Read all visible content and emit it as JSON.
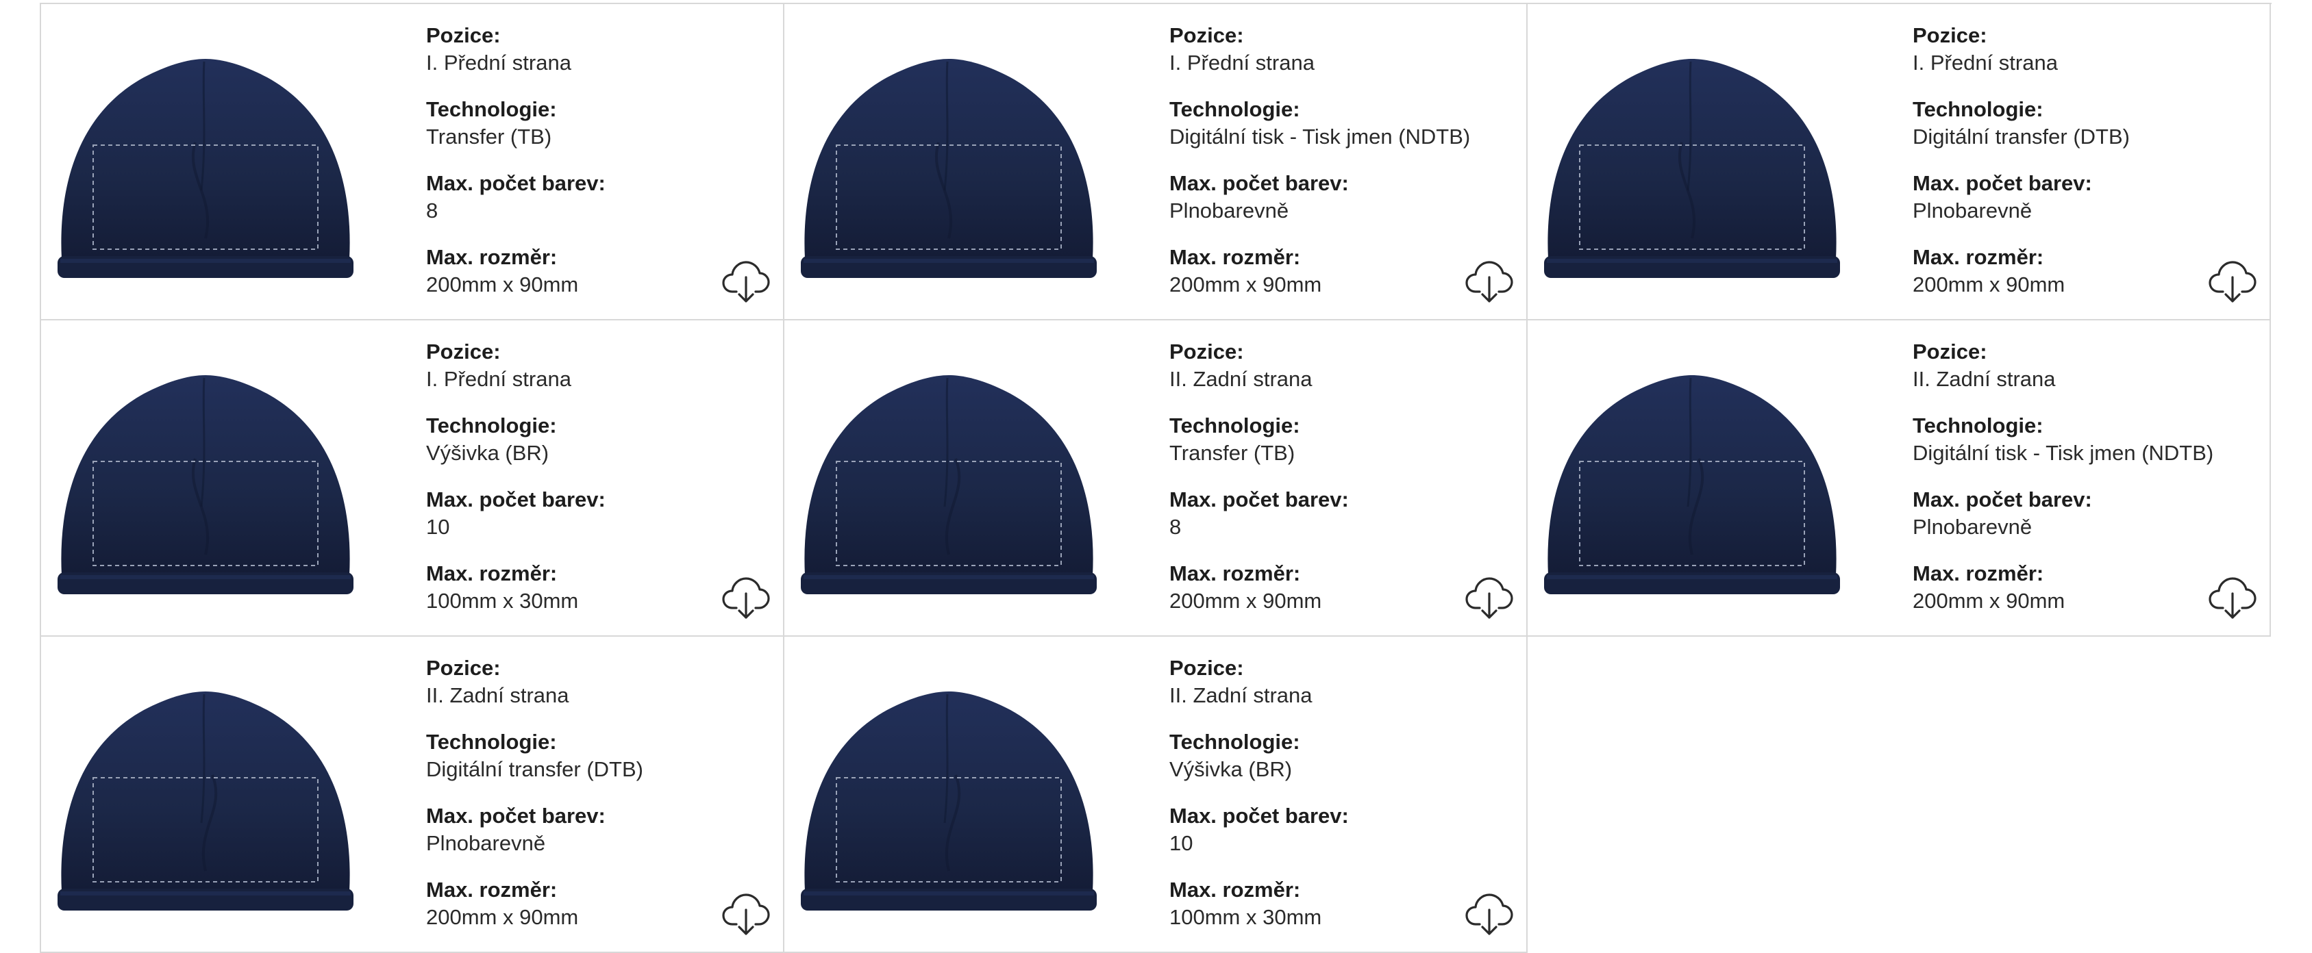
{
  "labels": {
    "position": "Pozice:",
    "technology": "Technologie:",
    "max_colors": "Max. počet barev:",
    "max_size": "Max. rozměr:"
  },
  "product_color": "#1b2747",
  "icons": {
    "download": "cloud-download-icon",
    "product": "beanie-hat-image"
  },
  "cards": [
    {
      "position": "I. Přední strana",
      "technology": "Transfer (TB)",
      "max_colors": "8",
      "max_size": "200mm x 90mm",
      "print_area": "wide"
    },
    {
      "position": "I. Přední strana",
      "technology": "Digitální tisk - Tisk jmen (NDTB)",
      "max_colors": "Plnobarevně",
      "max_size": "200mm x 90mm",
      "print_area": "wide"
    },
    {
      "position": "I. Přední strana",
      "technology": "Digitální transfer (DTB)",
      "max_colors": "Plnobarevně",
      "max_size": "200mm x 90mm",
      "print_area": "wide"
    },
    {
      "position": "I. Přední strana",
      "technology": "Výšivka (BR)",
      "max_colors": "10",
      "max_size": "100mm x 30mm",
      "print_area": "wide"
    },
    {
      "position": "II. Zadní strana",
      "technology": "Transfer (TB)",
      "max_colors": "8",
      "max_size": "200mm x 90mm",
      "print_area": "wide"
    },
    {
      "position": "II. Zadní strana",
      "technology": "Digitální tisk - Tisk jmen (NDTB)",
      "max_colors": "Plnobarevně",
      "max_size": "200mm x 90mm",
      "print_area": "wide"
    },
    {
      "position": "II. Zadní strana",
      "technology": "Digitální transfer (DTB)",
      "max_colors": "Plnobarevně",
      "max_size": "200mm x 90mm",
      "print_area": "wide"
    },
    {
      "position": "II. Zadní strana",
      "technology": "Výšivka (BR)",
      "max_colors": "10",
      "max_size": "100mm x 30mm",
      "print_area": "wide"
    }
  ]
}
